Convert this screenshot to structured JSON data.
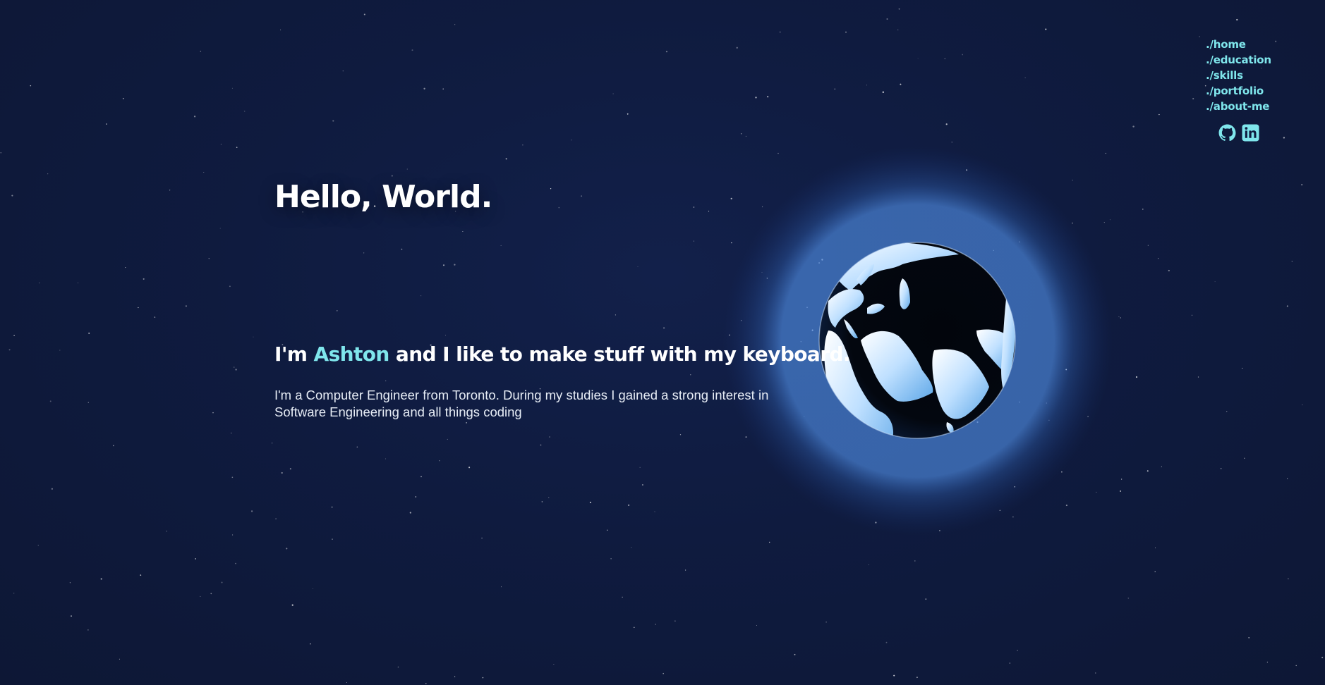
{
  "nav": {
    "items": [
      {
        "label": "./home"
      },
      {
        "label": "./education"
      },
      {
        "label": "./skills"
      },
      {
        "label": "./portfolio"
      },
      {
        "label": "./about-me"
      }
    ],
    "social": [
      {
        "icon": "github-icon"
      },
      {
        "icon": "linkedin-icon"
      }
    ]
  },
  "hero": {
    "greeting": "Hello, World.",
    "intro_prefix": "I'm ",
    "intro_name": "Ashton",
    "intro_suffix": " and I like to make stuff with my keyboard.",
    "description": "I'm a Computer Engineer from Toronto. During my studies I gained a strong interest in Software Engineering and all things coding"
  },
  "colors": {
    "background": "#0f1b3f",
    "accent": "#7fe6ec",
    "text": "#ffffff",
    "globe_glow": "#5aa0ff"
  }
}
